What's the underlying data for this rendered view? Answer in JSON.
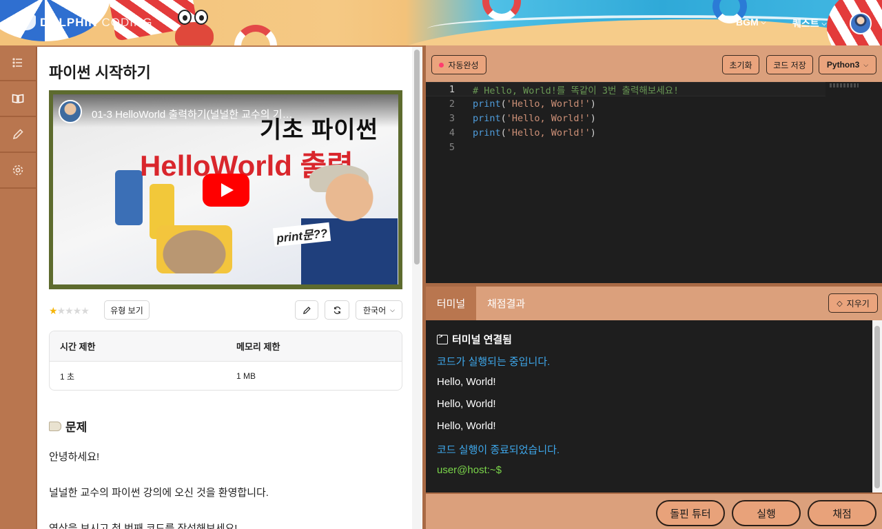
{
  "header": {
    "logo_main": "DOLPHIN",
    "logo_sub": "CODING",
    "nav": [
      {
        "label": "BGM"
      },
      {
        "label": "퀘스트"
      }
    ]
  },
  "problem": {
    "title": "파이썬 시작하기",
    "video": {
      "caption": "01-3 HelloWorld 출력하기(널널한 교수의 기초 파이...",
      "thumb_text_top": "기초 파이썬",
      "thumb_text_main": "HelloWorld 출력",
      "thumb_text_bubble": "print문??"
    },
    "rating": {
      "filled": 1,
      "total": 5
    },
    "type_button": "유형 보기",
    "language_select": "한국어",
    "limits": {
      "headers": [
        "시간 제한",
        "메모리 제한"
      ],
      "values": [
        "1 초",
        "1 MB"
      ]
    },
    "section_title": "문제",
    "paragraphs": [
      "안녕하세요!",
      "널널한 교수의 파이썬 강의에 오신 것을 환영합니다.",
      "영상을 보시고 첫 번째 코드를 작성해보세요!"
    ]
  },
  "editor": {
    "autocomplete_label": "자동완성",
    "reset_label": "초기화",
    "save_label": "코드 저장",
    "language": "Python3",
    "lines": [
      {
        "n": "1",
        "comment": "# Hello, World!를 똑같이 3번 출력해보세요!"
      },
      {
        "n": "2",
        "fn": "print",
        "open": "(",
        "str": "'Hello, World!'",
        "close": ")"
      },
      {
        "n": "3",
        "fn": "print",
        "open": "(",
        "str": "'Hello, World!'",
        "close": ")"
      },
      {
        "n": "4",
        "fn": "print",
        "open": "(",
        "str": "'Hello, World!'",
        "close": ")"
      },
      {
        "n": "5"
      }
    ]
  },
  "terminal": {
    "tabs": [
      "터미널",
      "채점결과"
    ],
    "clear_label": "지우기",
    "lines": [
      "터미널 연결됨",
      "코드가 실행되는 중입니다.",
      "Hello, World!",
      "Hello, World!",
      "Hello, World!",
      "코드 실행이 종료되었습니다.",
      "user@host:~$"
    ]
  },
  "actions": {
    "tutor": "돌핀 튜터",
    "run": "실행",
    "grade": "채점"
  },
  "colors": {
    "accent_brown": "#b9764f",
    "panel_tan": "#dba07c",
    "info_blue": "#3ea8ec",
    "prompt_green": "#7bd64a"
  }
}
